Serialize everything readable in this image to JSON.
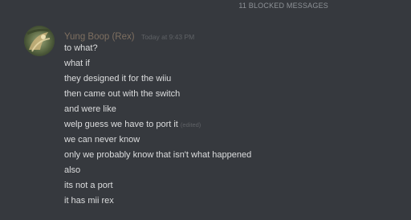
{
  "banner": {
    "blocked_text": "11 BLOCKED MESSAGES"
  },
  "message": {
    "author": "Yung Boop (Rex)",
    "timestamp": "Today at 9:43 PM",
    "avatar_icon": "avatar-image-icon",
    "lines": [
      {
        "text": "to what?",
        "edited": ""
      },
      {
        "text": "what if",
        "edited": ""
      },
      {
        "text": "they designed it for the wiiu",
        "edited": ""
      },
      {
        "text": "then came out with the switch",
        "edited": ""
      },
      {
        "text": "and were like",
        "edited": ""
      },
      {
        "text": "welp guess we have to port it",
        "edited": "(edited)"
      },
      {
        "text": "we can never know",
        "edited": ""
      },
      {
        "text": "only we probably know that isn't what happened",
        "edited": ""
      },
      {
        "text": "also",
        "edited": ""
      },
      {
        "text": "its not a port",
        "edited": ""
      },
      {
        "text": "it has mii rex",
        "edited": ""
      }
    ]
  },
  "colors": {
    "background": "#36393e",
    "username": "#7e6f60",
    "message_text": "#dcddde",
    "muted": "#5f6266"
  }
}
